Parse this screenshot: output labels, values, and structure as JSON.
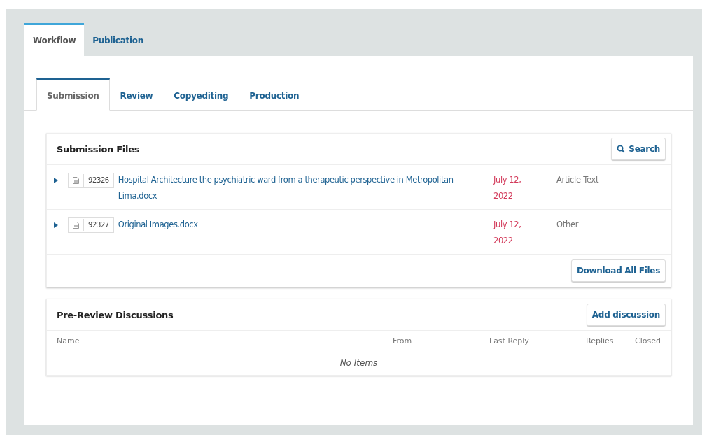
{
  "top_tabs": [
    {
      "label": "Workflow",
      "selected": true
    },
    {
      "label": "Publication",
      "selected": false
    }
  ],
  "stage_tabs": [
    {
      "label": "Submission",
      "selected": true
    },
    {
      "label": "Review",
      "selected": false
    },
    {
      "label": "Copyediting",
      "selected": false
    },
    {
      "label": "Production",
      "selected": false
    }
  ],
  "submission_files": {
    "title": "Submission Files",
    "search_button": "Search",
    "rows": [
      {
        "id": "92326",
        "name": "Hospital Architecture the psychiatric ward from a therapeutic perspective in Metropolitan Lima.docx",
        "date": "July 12, 2022",
        "type": "Article Text"
      },
      {
        "id": "92327",
        "name": "Original Images.docx",
        "date": "July 12, 2022",
        "type": "Other"
      }
    ],
    "download_button": "Download All Files"
  },
  "discussions": {
    "title": "Pre-Review Discussions",
    "add_button": "Add discussion",
    "columns": [
      "Name",
      "From",
      "Last Reply",
      "Replies",
      "Closed"
    ],
    "empty": "No Items"
  }
}
